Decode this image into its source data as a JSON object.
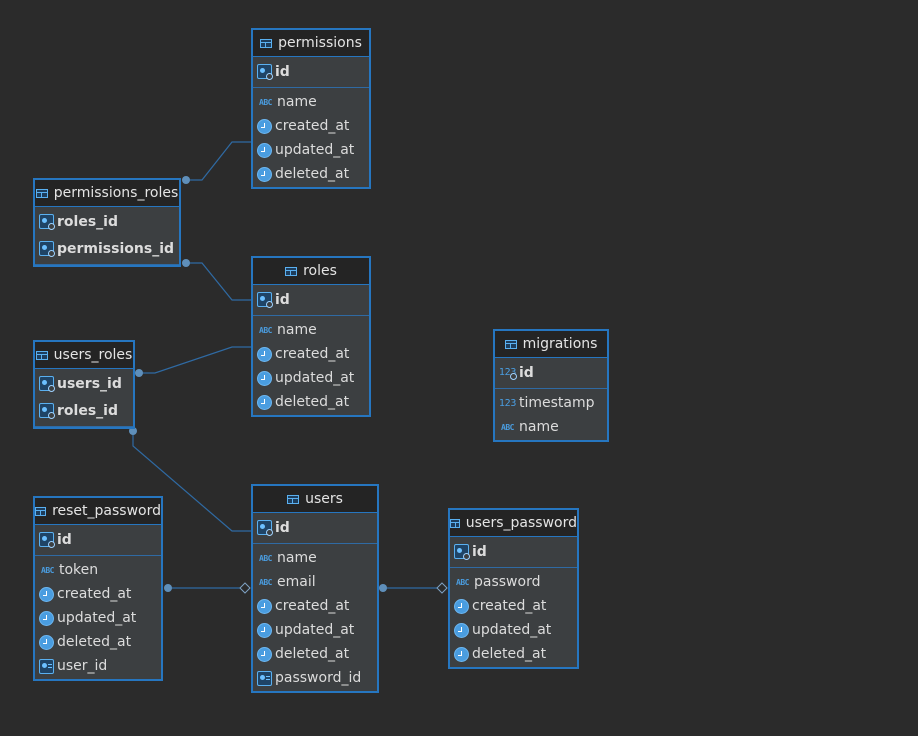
{
  "tables": [
    {
      "id": "permissions",
      "name": "permissions",
      "columns": [
        {
          "name": "id",
          "type": "pk"
        },
        {
          "name": "name",
          "type": "text"
        },
        {
          "name": "created_at",
          "type": "time"
        },
        {
          "name": "updated_at",
          "type": "time"
        },
        {
          "name": "deleted_at",
          "type": "time"
        }
      ]
    },
    {
      "id": "permissions_roles",
      "name": "permissions_roles",
      "columns": [
        {
          "name": "roles_id",
          "type": "pk"
        },
        {
          "name": "permissions_id",
          "type": "pk"
        }
      ]
    },
    {
      "id": "roles",
      "name": "roles",
      "columns": [
        {
          "name": "id",
          "type": "pk"
        },
        {
          "name": "name",
          "type": "text"
        },
        {
          "name": "created_at",
          "type": "time"
        },
        {
          "name": "updated_at",
          "type": "time"
        },
        {
          "name": "deleted_at",
          "type": "time"
        }
      ]
    },
    {
      "id": "users_roles",
      "name": "users_roles",
      "columns": [
        {
          "name": "users_id",
          "type": "pk"
        },
        {
          "name": "roles_id",
          "type": "pk"
        }
      ]
    },
    {
      "id": "migrations",
      "name": "migrations",
      "columns": [
        {
          "name": "id",
          "type": "pk-number"
        },
        {
          "name": "timestamp",
          "type": "number"
        },
        {
          "name": "name",
          "type": "text"
        }
      ]
    },
    {
      "id": "reset_password",
      "name": "reset_password",
      "columns": [
        {
          "name": "id",
          "type": "pk"
        },
        {
          "name": "token",
          "type": "text"
        },
        {
          "name": "created_at",
          "type": "time"
        },
        {
          "name": "updated_at",
          "type": "time"
        },
        {
          "name": "deleted_at",
          "type": "time"
        },
        {
          "name": "user_id",
          "type": "fk"
        }
      ]
    },
    {
      "id": "users",
      "name": "users",
      "columns": [
        {
          "name": "id",
          "type": "pk"
        },
        {
          "name": "name",
          "type": "text"
        },
        {
          "name": "email",
          "type": "text"
        },
        {
          "name": "created_at",
          "type": "time"
        },
        {
          "name": "updated_at",
          "type": "time"
        },
        {
          "name": "deleted_at",
          "type": "time"
        },
        {
          "name": "password_id",
          "type": "fk"
        }
      ]
    },
    {
      "id": "users_password",
      "name": "users_password",
      "columns": [
        {
          "name": "id",
          "type": "pk"
        },
        {
          "name": "password",
          "type": "text"
        },
        {
          "name": "created_at",
          "type": "time"
        },
        {
          "name": "updated_at",
          "type": "time"
        },
        {
          "name": "deleted_at",
          "type": "time"
        }
      ]
    }
  ],
  "relationships": [
    {
      "from": "permissions_roles",
      "to": "permissions",
      "start_marker": "dot"
    },
    {
      "from": "permissions_roles",
      "to": "roles",
      "start_marker": "dot"
    },
    {
      "from": "users_roles",
      "to": "roles",
      "start_marker": "dot"
    },
    {
      "from": "users_roles",
      "to": "users",
      "start_marker": "dot"
    },
    {
      "from": "reset_password",
      "to": "users",
      "start_marker": "dot",
      "end_marker": "diamond"
    },
    {
      "from": "users",
      "to": "users_password",
      "start_marker": "dot",
      "end_marker": "diamond"
    }
  ],
  "colors": {
    "background": "#2b2b2b",
    "table_fill": "#3c3f41",
    "table_border": "#2676c0",
    "header_fill": "#242424",
    "connector": "#2f6aa3",
    "icon_blue": "#4a9de0"
  },
  "icon_names": {
    "text": "abc-icon",
    "time": "clock-icon",
    "pk": "primary-key-icon",
    "fk": "foreign-key-icon",
    "number": "number-123-icon",
    "pk-number": "number-key-icon"
  }
}
